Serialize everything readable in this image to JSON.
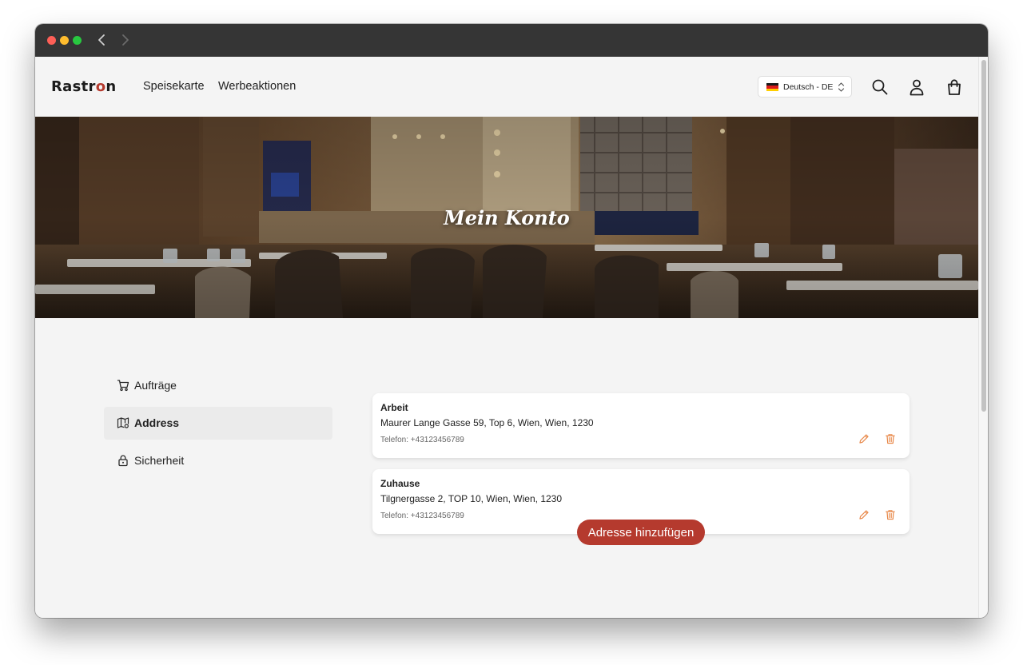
{
  "header": {
    "logo_text": "Rastr",
    "logo_accent": "o",
    "logo_tail": "n",
    "nav": [
      {
        "label": "Speisekarte"
      },
      {
        "label": "Werbeaktionen"
      }
    ],
    "language": {
      "label": "Deutsch - DE",
      "flag": "germany-flag"
    }
  },
  "hero": {
    "title": "Mein Konto"
  },
  "sidebar": {
    "items": [
      {
        "label": "Aufträge",
        "icon": "cart-icon",
        "active": false
      },
      {
        "label": "Address",
        "icon": "map-icon",
        "active": true
      },
      {
        "label": "Sicherheit",
        "icon": "lock-icon",
        "active": false
      }
    ]
  },
  "addresses": [
    {
      "name": "Arbeit",
      "line": "Maurer Lange Gasse 59, Top 6, Wien, Wien, 1230",
      "phone": "Telefon: +43123456789"
    },
    {
      "name": "Zuhause",
      "line": "Tilgnergasse 2, TOP 10, Wien, Wien, 1230",
      "phone": "Telefon: +43123456789"
    }
  ],
  "add_button": {
    "label": "Adresse hinzufügen"
  },
  "colors": {
    "accent": "#b53a2e",
    "icon_orange": "#e8894a",
    "page_bg": "#f4f4f4"
  }
}
